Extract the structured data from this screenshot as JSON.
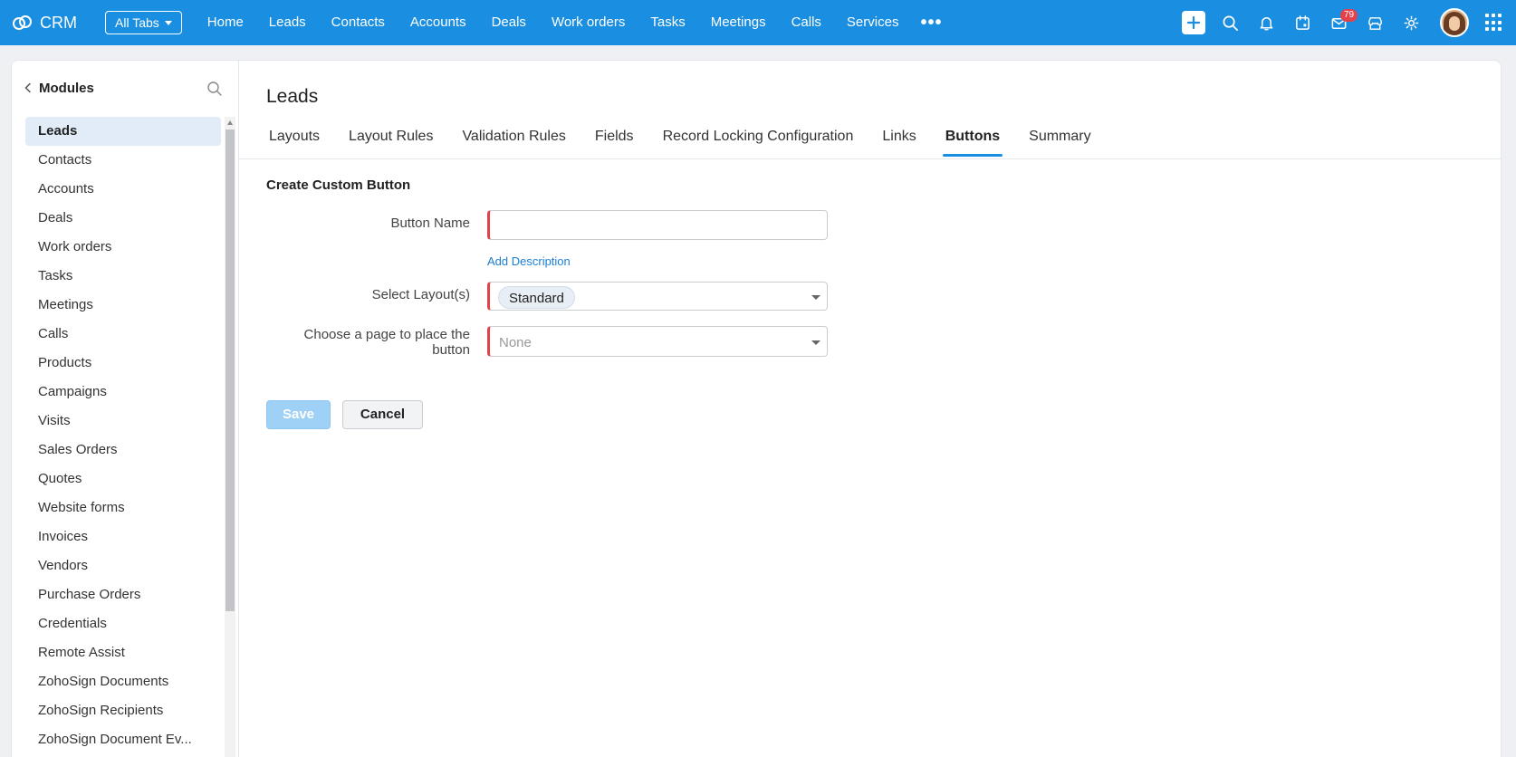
{
  "topbar": {
    "brand": "CRM",
    "all_tabs": "All Tabs",
    "nav": [
      "Home",
      "Leads",
      "Contacts",
      "Accounts",
      "Deals",
      "Work orders",
      "Tasks",
      "Meetings",
      "Calls",
      "Services"
    ],
    "mail_badge": "79",
    "colors": {
      "bar": "#1a8ee0",
      "badge": "#e5414b"
    }
  },
  "sidebar": {
    "title": "Modules",
    "items": [
      "Leads",
      "Contacts",
      "Accounts",
      "Deals",
      "Work orders",
      "Tasks",
      "Meetings",
      "Calls",
      "Products",
      "Campaigns",
      "Visits",
      "Sales Orders",
      "Quotes",
      "Website forms",
      "Invoices",
      "Vendors",
      "Purchase Orders",
      "Credentials",
      "Remote Assist",
      "ZohoSign Documents",
      "ZohoSign Recipients",
      "ZohoSign Document Ev..."
    ],
    "active": "Leads"
  },
  "main": {
    "title": "Leads",
    "tabs": [
      "Layouts",
      "Layout Rules",
      "Validation Rules",
      "Fields",
      "Record Locking Configuration",
      "Links",
      "Buttons",
      "Summary"
    ],
    "active_tab": "Buttons",
    "section_title": "Create Custom Button",
    "form": {
      "button_name_label": "Button Name",
      "button_name_value": "",
      "add_description": "Add Description",
      "layouts_label": "Select Layout(s)",
      "layouts_selected": "Standard",
      "page_label_line1": "Choose a page to place the",
      "page_label_line2": "button",
      "page_placeholder": "None"
    },
    "save_label": "Save",
    "cancel_label": "Cancel"
  }
}
